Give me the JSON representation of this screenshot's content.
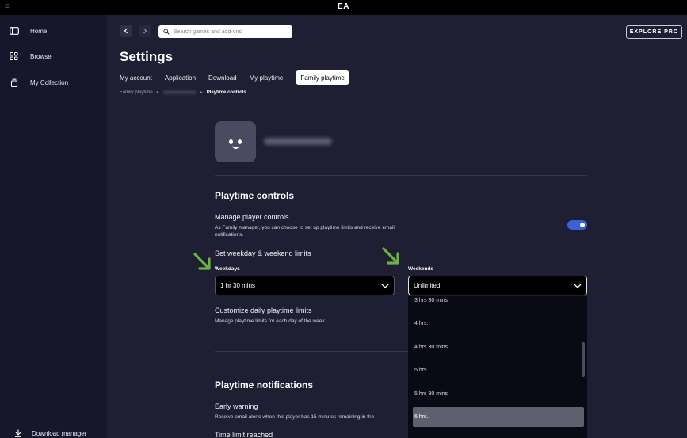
{
  "app": {
    "title": "EA",
    "menu_glyph": "≡"
  },
  "sidebar": {
    "items": [
      {
        "label": "Home",
        "icon": "home-icon"
      },
      {
        "label": "Browse",
        "icon": "grid-icon"
      },
      {
        "label": "My Collection",
        "icon": "collection-icon"
      }
    ],
    "download_manager": "Download manager"
  },
  "header": {
    "search_placeholder": "Search games and add-ons",
    "explore_pro": "EXPLORE PRO"
  },
  "settings": {
    "title": "Settings",
    "tabs": [
      "My account",
      "Application",
      "Download",
      "My playtime",
      "Family playtime"
    ],
    "active_tab": "Family playtime",
    "breadcrumb": {
      "root": "Family playtime",
      "current": "Playtime controls"
    }
  },
  "playtime_controls": {
    "title": "Playtime controls",
    "manage_label": "Manage player controls",
    "manage_desc_1": "As Family manager, you can choose to set up playtime limits and receive email",
    "manage_desc_2": "notifications.",
    "manage_enabled": true,
    "limits_label": "Set weekday & weekend limits",
    "weekdays_label": "Weekdays",
    "weekdays_value": "1 hr 30 mins",
    "weekends_label": "Weekends",
    "weekends_value": "Unlimited",
    "customize_label": "Customize daily playtime limits",
    "customize_desc": "Manage playtime limits for each day of the week."
  },
  "dropdown": {
    "options": [
      "3 hrs 30 mins",
      "4 hrs.",
      "4 hrs 30 mins",
      "5 hrs.",
      "5 hrs 30 mins",
      "6 hrs."
    ],
    "selected": "6 hrs."
  },
  "notifications": {
    "title": "Playtime notifications",
    "early_warning_label": "Early warning",
    "early_warning_desc": "Receive email alerts when this player has 15 minutes remaining in the",
    "time_limit_label": "Time limit reached"
  },
  "colors": {
    "accent": "#3a5fd8",
    "annotation_arrow": "#6cb33f"
  }
}
